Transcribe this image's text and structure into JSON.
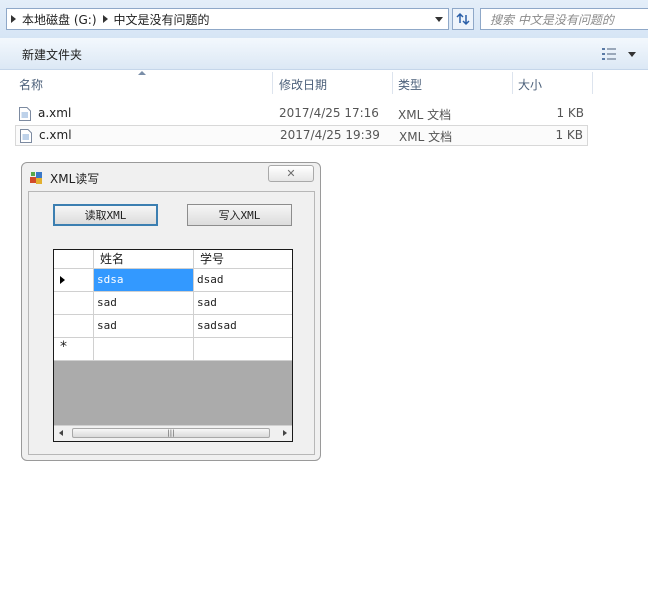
{
  "explorer": {
    "breadcrumbs": [
      "本地磁盘 (G:)",
      "中文是没有问题的"
    ],
    "search_placeholder": "搜索 中文是没有问题的",
    "toolbar": {
      "new_folder": "新建文件夹"
    },
    "columns": {
      "name": "名称",
      "modified": "修改日期",
      "type": "类型",
      "size": "大小"
    },
    "files": [
      {
        "name": "a.xml",
        "date": "2017/4/25 17:16",
        "type": "XML 文档",
        "size": "1 KB"
      },
      {
        "name": "c.xml",
        "date": "2017/4/25 19:39",
        "type": "XML 文档",
        "size": "1 KB"
      }
    ]
  },
  "dialog": {
    "title": "XML读写",
    "close_glyph": "✕",
    "read_button": "读取XML",
    "write_button": "写入XML",
    "grid": {
      "headers": [
        "姓名",
        "学号"
      ],
      "rows": [
        [
          "sdsa",
          "dsad"
        ],
        [
          "sad",
          "sad"
        ],
        [
          "sad",
          "sadsad"
        ]
      ],
      "new_row_marker": "*",
      "scroll_grip": "|||"
    }
  },
  "colors": {
    "selection": "#3399ff",
    "grid_background": "#ababab",
    "dialog_background": "#f0f0f0"
  }
}
